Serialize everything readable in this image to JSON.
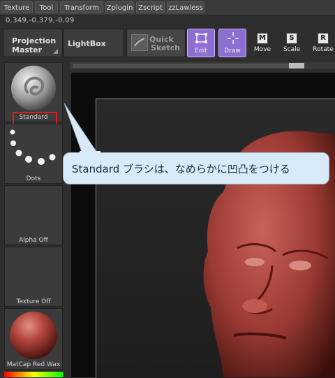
{
  "menu": {
    "items": [
      "Texture",
      "Tool",
      "Transform",
      "Zplugin",
      "Zscript",
      "zzLawless"
    ]
  },
  "coords": {
    "x": "0.349",
    "y": "-0.379",
    "z": "-0.09"
  },
  "toolbar": {
    "projection_line1": "Projection",
    "projection_line2": "Master",
    "lightbox": "LightBox",
    "quick_sketch_line1": "Quick",
    "quick_sketch_line2": "Sketch",
    "edit": "Edit",
    "draw": "Draw",
    "move": "Move",
    "move_key": "M",
    "scale": "Scale",
    "scale_key": "S",
    "rotate": "Rotate",
    "rotate_key": "R"
  },
  "shelf": {
    "brush": "Standard",
    "stroke": "Dots",
    "alpha": "Alpha Off",
    "texture": "Texture Off",
    "material": "MatCap Red Wax"
  },
  "callout": {
    "text": "Standard ブラシは、なめらかに凹凸をつける"
  },
  "colors": {
    "accent_purple": "#8c6fd0",
    "highlight_red": "#e21b1b",
    "callout_bg": "#d8e9f7",
    "wax_red": "#b2453c"
  }
}
